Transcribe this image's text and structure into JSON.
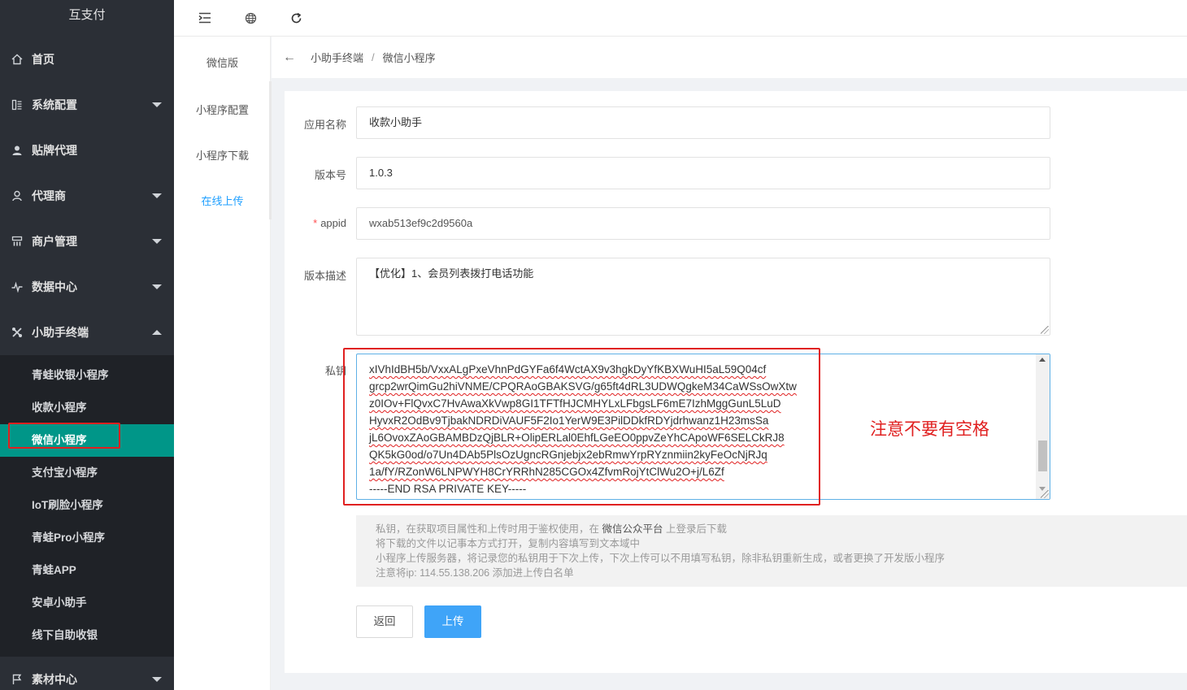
{
  "sidebar": {
    "logo": "互支付",
    "menu": [
      {
        "label": "首页",
        "icon": "home-icon"
      },
      {
        "label": "系统配置",
        "icon": "settings-icon"
      },
      {
        "label": "贴牌代理",
        "icon": "user-icon"
      },
      {
        "label": "代理商",
        "icon": "person-icon"
      },
      {
        "label": "商户管理",
        "icon": "grid-icon"
      },
      {
        "label": "数据中心",
        "icon": "pulse-icon"
      },
      {
        "label": "小助手终端",
        "icon": "tools-icon"
      }
    ],
    "submenu": [
      "青蛙收银小程序",
      "收款小程序",
      "微信小程序",
      "支付宝小程序",
      "IoT刷脸小程序",
      "青蛙Pro小程序",
      "青蛙APP",
      "安卓小助手",
      "线下自助收银"
    ],
    "bottom": {
      "label": "素材中心",
      "icon": "flag-icon"
    }
  },
  "subnav": [
    "微信版",
    "小程序配置",
    "小程序下载",
    "在线上传"
  ],
  "breadcrumb": {
    "parent": "小助手终端",
    "sep": "/",
    "current": "微信小程序"
  },
  "form": {
    "app_name_label": "应用名称",
    "app_name_value": "收款小助手",
    "version_label": "版本号",
    "version_value": "1.0.3",
    "appid_required": "*",
    "appid_label": "appid",
    "appid_value": "wxab513ef9c2d9560a",
    "desc_label": "版本描述",
    "desc_value": "【优化】1、会员列表拨打电话功能",
    "key_label": "私钥",
    "key_lines": [
      "xIVhIdBH5b/VxxALgPxeVhnPdGYFa6f4WctAX9v3hgkDyYfKBXWuHI5aL59Q04cf",
      "grcp2wrQimGu2hiVNME/CPQRAoGBAKSVG/g65ft4dRL3UDWQgkeM34CaWSsOwXtw",
      "z0IOv+FlQvxC7HvAwaXkVwp8GI1TFTfHJCMHYLxLFbgsLF6mE7IzhMggGunL5LuD",
      "HyvxR2OdBv9TjbakNDRDiVAUF5F2Io1YerW9E3PilDDkfRDYjdrhwanz1H23msSa",
      "jL6OvoxZAoGBAMBDzQjBLR+OlipERLal0EhfLGeEO0ppvZeYhCApoWF6SELCkRJ8",
      "QK5kG0od/o7Un4DAb5PlsOzUgncRGnjebjx2ebRmwYrpRYznmiin2kyFeOcNjRJq",
      "1a/fY/RZonW6LNPWYH8CrYRRhN285CGOx4ZfvmRojYtClWu2O+j/L6Zf",
      "-----END RSA PRIVATE KEY-----"
    ],
    "annotation": "注意不要有空格",
    "hint_lines": [
      "私钥，在获取项目属性和上传时用于鉴权使用，在",
      "微信公众平台",
      "上登录后下载",
      "将下载的文件以记事本方式打开，复制内容填写到文本域中",
      "小程序上传服务器，将记录您的私钥用于下次上传，下次上传可以不用填写私钥，除非私钥重新生成，或者更换了开发版小程序",
      "注意将ip: 114.55.138.206 添加进上传白名单"
    ],
    "back_button": "返回",
    "upload_button": "上传"
  },
  "colors": {
    "sidebar_bg": "#2b2f36",
    "active_green": "#009688",
    "accent_blue": "#3fa4f8",
    "annotation_red": "#e02020"
  }
}
